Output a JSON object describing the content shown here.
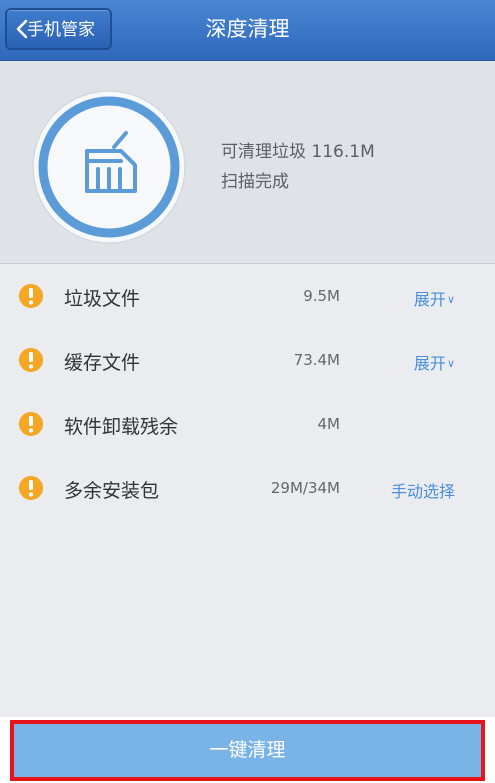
{
  "header": {
    "back_label": "手机管家",
    "title": "深度清理"
  },
  "summary": {
    "size_text": "可清理垃圾 116.1M",
    "status_text": "扫描完成",
    "icon": "broom-icon"
  },
  "items": [
    {
      "label": "垃圾文件",
      "size": "9.5M",
      "action": "展开",
      "action_chevron": "∨",
      "icon": "warning-icon"
    },
    {
      "label": "缓存文件",
      "size": "73.4M",
      "action": "展开",
      "action_chevron": "∨",
      "icon": "warning-icon"
    },
    {
      "label": "软件卸载残余",
      "size": "4M",
      "action": "",
      "action_chevron": "",
      "icon": "warning-icon"
    },
    {
      "label": "多余安装包",
      "size": "29M/34M",
      "action": "手动选择",
      "action_chevron": "",
      "icon": "warning-icon"
    }
  ],
  "footer": {
    "clean_button": "一键清理"
  },
  "colors": {
    "header": "#3a76c8",
    "accent": "#4a8fd8",
    "warning": "#f5a623",
    "clean_button": "#7ab3e6",
    "highlight_border": "#e8141c"
  }
}
